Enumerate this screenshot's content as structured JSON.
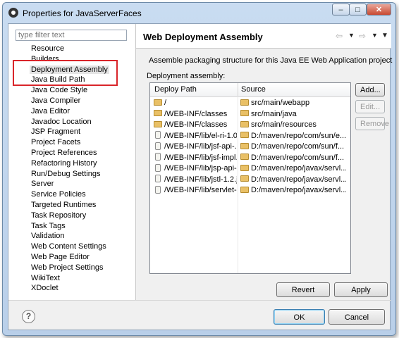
{
  "window": {
    "title": "Properties for JavaServerFaces",
    "minimize_glyph": "–",
    "maximize_glyph": "□",
    "close_glyph": "✕"
  },
  "sidebar": {
    "filter_placeholder": "type filter text",
    "items": [
      {
        "label": "Resource"
      },
      {
        "label": "Builders"
      },
      {
        "label": "Deployment Assembly",
        "selected": true
      },
      {
        "label": "Java Build Path"
      },
      {
        "label": "Java Code Style"
      },
      {
        "label": "Java Compiler"
      },
      {
        "label": "Java Editor"
      },
      {
        "label": "Javadoc Location"
      },
      {
        "label": "JSP Fragment"
      },
      {
        "label": "Project Facets"
      },
      {
        "label": "Project References"
      },
      {
        "label": "Refactoring History"
      },
      {
        "label": "Run/Debug Settings"
      },
      {
        "label": "Server"
      },
      {
        "label": "Service Policies"
      },
      {
        "label": "Targeted Runtimes"
      },
      {
        "label": "Task Repository"
      },
      {
        "label": "Task Tags"
      },
      {
        "label": "Validation"
      },
      {
        "label": "Web Content Settings"
      },
      {
        "label": "Web Page Editor"
      },
      {
        "label": "Web Project Settings"
      },
      {
        "label": "WikiText"
      },
      {
        "label": "XDoclet"
      }
    ]
  },
  "page": {
    "title": "Web Deployment Assembly",
    "nav_back_icon": "arrow-left-icon",
    "nav_forward_icon": "arrow-right-icon",
    "description": "Assemble packaging structure for this Java EE Web Application project",
    "assembly_label": "Deployment assembly:",
    "table": {
      "columns": [
        "Deploy Path",
        "Source"
      ],
      "rows": [
        {
          "deploy": "/",
          "source": "src/main/webapp",
          "deploy_icon": "folder-icon",
          "source_icon": "folder-icon"
        },
        {
          "deploy": "/WEB-INF/classes",
          "source": "src/main/java",
          "deploy_icon": "folder-icon",
          "source_icon": "folder-icon"
        },
        {
          "deploy": "/WEB-INF/classes",
          "source": "src/main/resources",
          "deploy_icon": "folder-icon",
          "source_icon": "folder-icon"
        },
        {
          "deploy": "/WEB-INF/lib/el-ri-1.0...",
          "source": "D:/maven/repo/com/sun/e...",
          "deploy_icon": "jar-icon",
          "source_icon": "folder-icon"
        },
        {
          "deploy": "/WEB-INF/lib/jsf-api-...",
          "source": "D:/maven/repo/com/sun/f...",
          "deploy_icon": "jar-icon",
          "source_icon": "folder-icon"
        },
        {
          "deploy": "/WEB-INF/lib/jsf-impl...",
          "source": "D:/maven/repo/com/sun/f...",
          "deploy_icon": "jar-icon",
          "source_icon": "folder-icon"
        },
        {
          "deploy": "/WEB-INF/lib/jsp-api-...",
          "source": "D:/maven/repo/javax/servl...",
          "deploy_icon": "jar-icon",
          "source_icon": "folder-icon"
        },
        {
          "deploy": "/WEB-INF/lib/jstl-1.2.j...",
          "source": "D:/maven/repo/javax/servl...",
          "deploy_icon": "jar-icon",
          "source_icon": "folder-icon"
        },
        {
          "deploy": "/WEB-INF/lib/servlet-...",
          "source": "D:/maven/repo/javax/servl...",
          "deploy_icon": "jar-icon",
          "source_icon": "folder-icon"
        }
      ]
    },
    "buttons": {
      "add": "Add...",
      "edit": "Edit...",
      "remove": "Remove",
      "revert": "Revert",
      "apply": "Apply"
    }
  },
  "footer": {
    "help": "?",
    "ok": "OK",
    "cancel": "Cancel"
  },
  "colors": {
    "highlight_box": "#d9252a",
    "title_bar": "#c9dcf1",
    "dialog_bg": "#f0f0f0"
  }
}
